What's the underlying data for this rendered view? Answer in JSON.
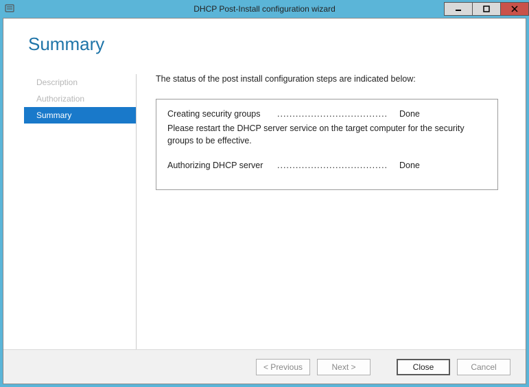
{
  "titlebar": {
    "title": "DHCP Post-Install configuration wizard"
  },
  "page": {
    "heading": "Summary"
  },
  "sidebar": {
    "items": [
      {
        "label": "Description"
      },
      {
        "label": "Authorization"
      },
      {
        "label": "Summary"
      }
    ]
  },
  "main": {
    "intro": "The status of the post install configuration steps are indicated below:",
    "steps": [
      {
        "label": "Creating security groups",
        "status": "Done"
      },
      {
        "label": "Authorizing DHCP server",
        "status": "Done"
      }
    ],
    "note": "Please restart the DHCP server service on the target computer for the security groups to be effective."
  },
  "footer": {
    "previous": "< Previous",
    "next": "Next >",
    "close": "Close",
    "cancel": "Cancel"
  }
}
